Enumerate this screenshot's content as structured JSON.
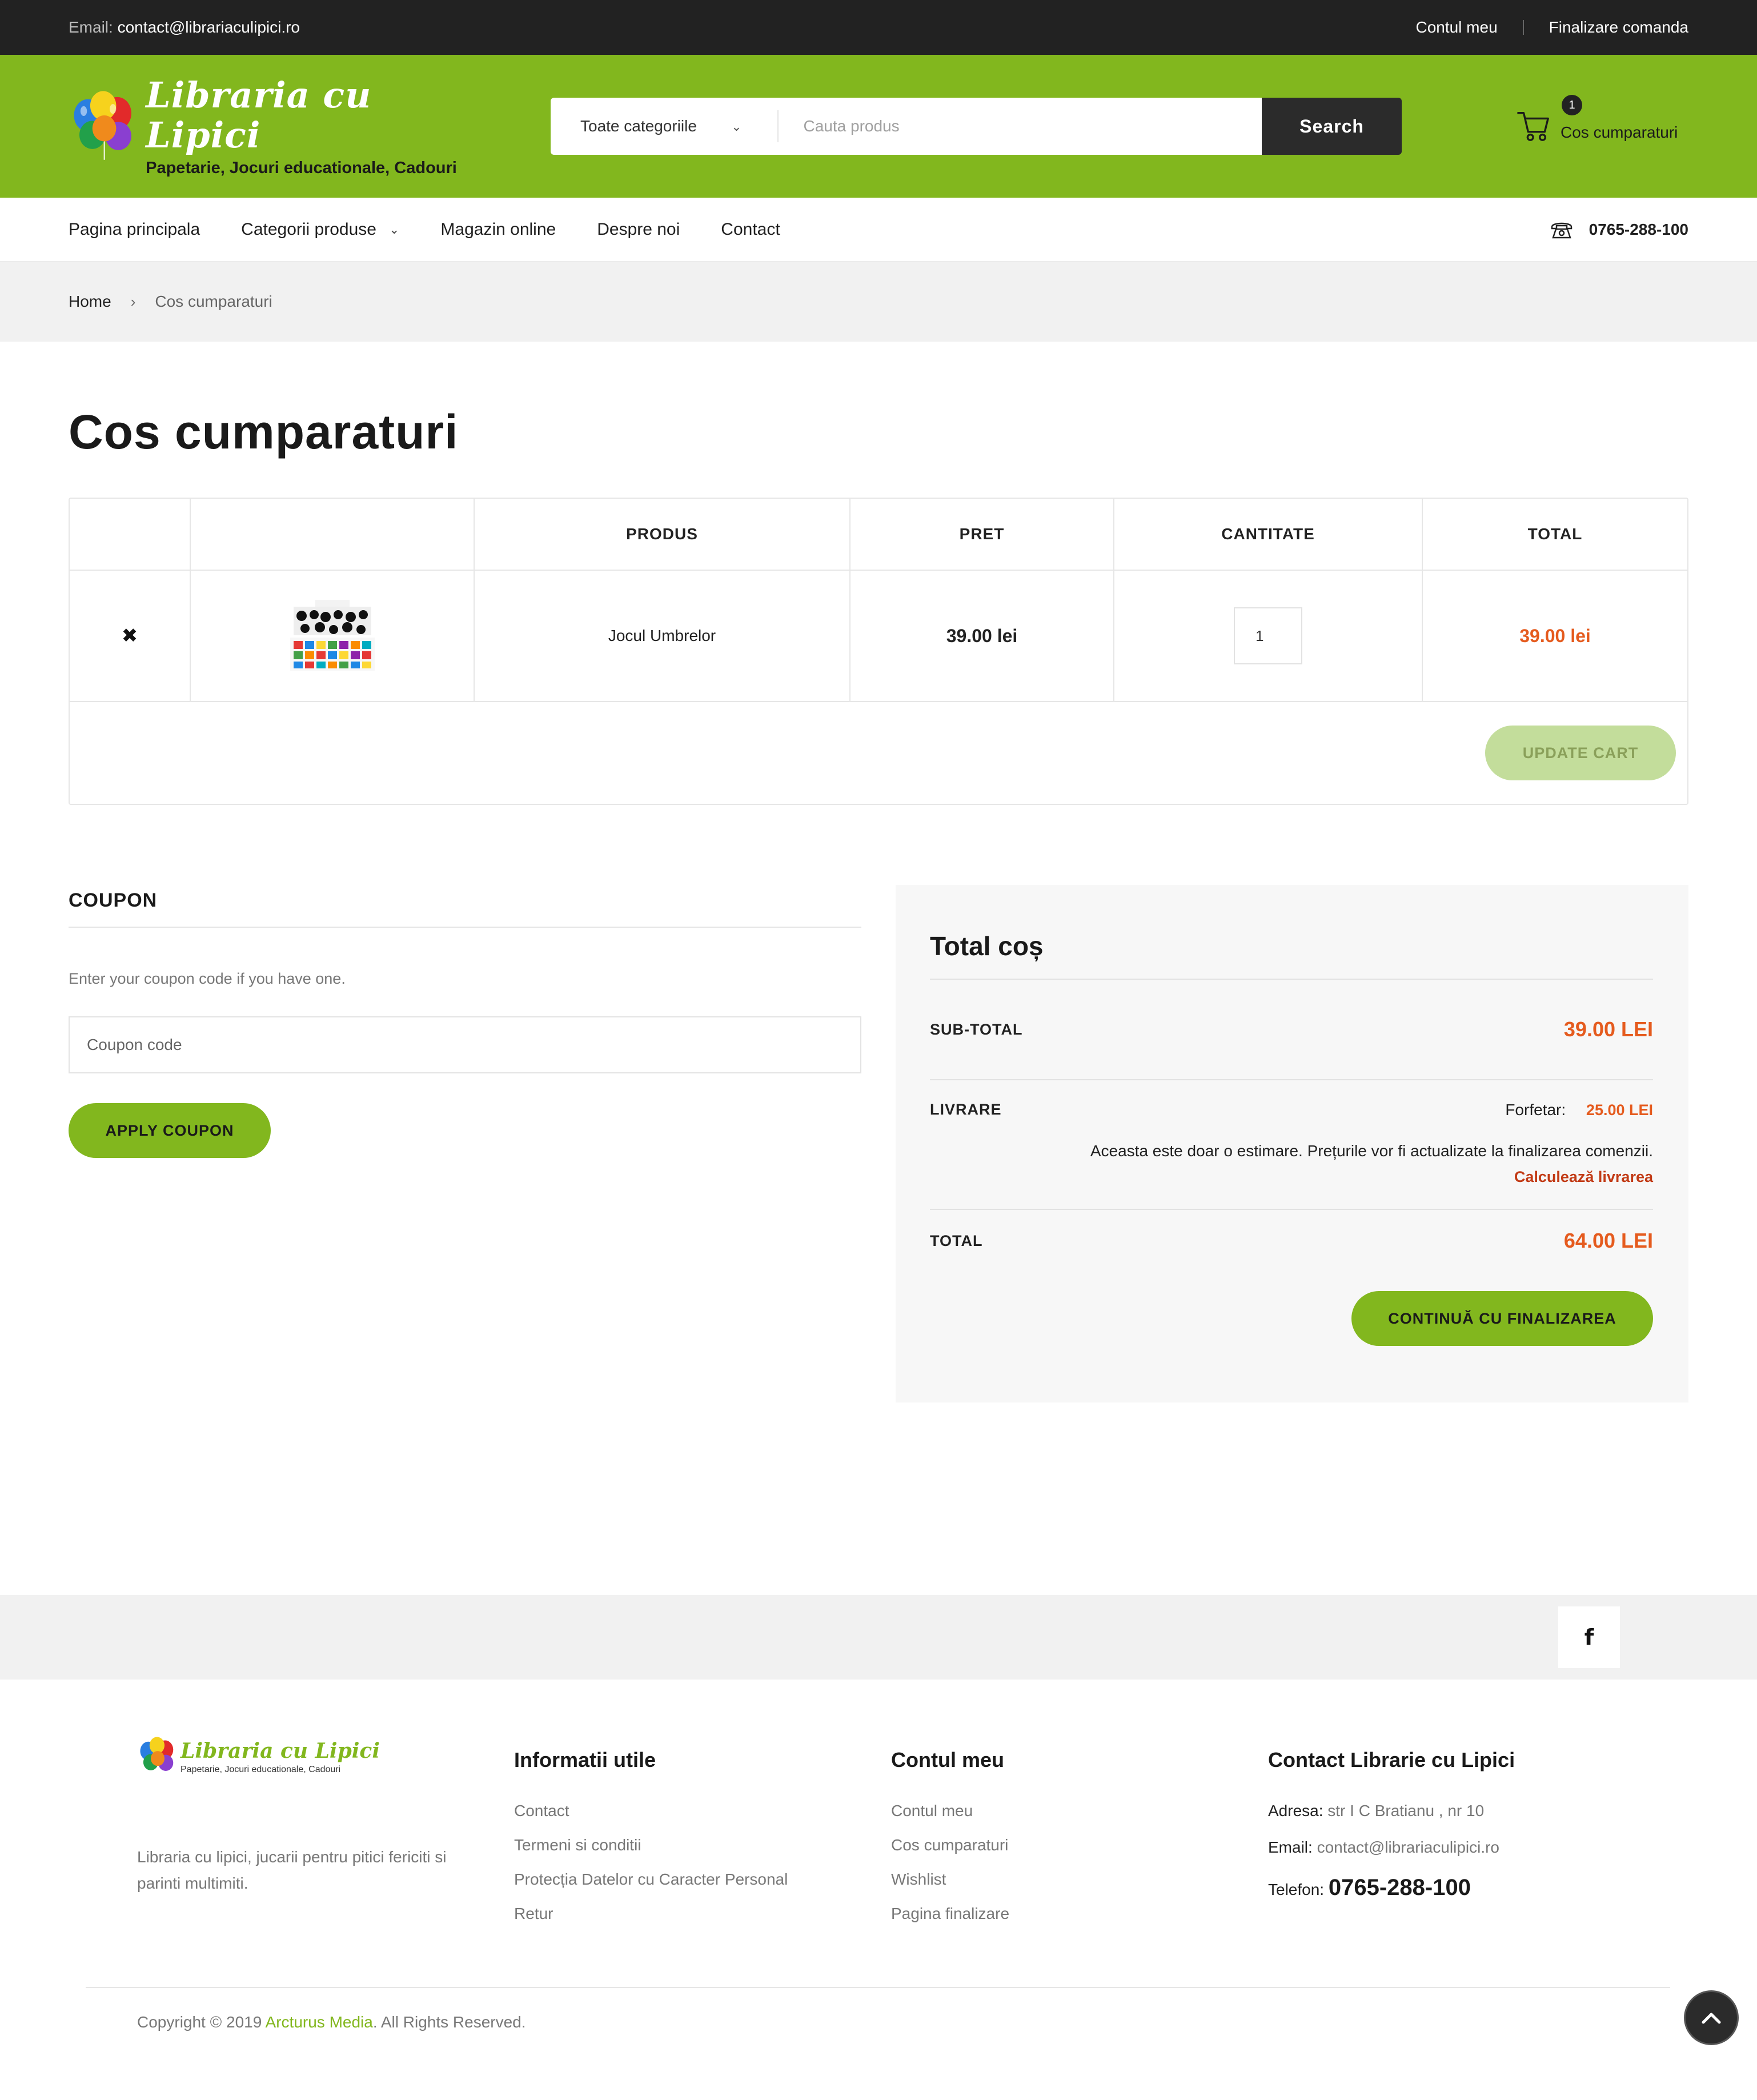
{
  "topbar": {
    "email_label": "Email:",
    "email_value": "contact@librariaculipici.ro",
    "account_link": "Contul meu",
    "checkout_link": "Finalizare comanda"
  },
  "header": {
    "logo_title": "Libraria cu Lipici",
    "logo_subtitle": "Papetarie, Jocuri educationale, Cadouri",
    "search_category": "Toate categoriile",
    "search_placeholder": "Cauta produs",
    "search_button": "Search",
    "cart_count": "1",
    "cart_label": "Cos cumparaturi"
  },
  "nav": {
    "items": [
      "Pagina principala",
      "Categorii produse",
      "Magazin online",
      "Despre noi",
      "Contact"
    ],
    "phone": "0765-288-100"
  },
  "breadcrumb": {
    "home": "Home",
    "current": "Cos cumparaturi"
  },
  "page": {
    "title": "Cos cumparaturi"
  },
  "cart_table": {
    "headers": [
      "",
      "",
      "PRODUS",
      "PRET",
      "CANTITATE",
      "TOTAL"
    ],
    "rows": [
      {
        "product": "Jocul Umbrelor",
        "price": "39.00 lei",
        "quantity": "1",
        "total": "39.00 lei"
      }
    ],
    "update_button": "UPDATE CART"
  },
  "coupon": {
    "title": "COUPON",
    "description": "Enter your coupon code if you have one.",
    "placeholder": "Coupon code",
    "apply_button": "APPLY COUPON"
  },
  "totals": {
    "title": "Total coș",
    "subtotal_label": "SUB-TOTAL",
    "subtotal_value": "39.00 LEI",
    "shipping_label": "LIVRARE",
    "shipping_rate_label": "Forfetar:",
    "shipping_rate_value": "25.00 LEI",
    "shipping_note": "Aceasta este doar o estimare. Prețurile vor fi actualizate la finalizarea comenzii.",
    "shipping_calc_link": "Calculează livrarea",
    "total_label": "TOTAL",
    "total_value": "64.00 LEI",
    "checkout_button": "CONTINUĂ CU FINALIZAREA"
  },
  "social": {
    "facebook_glyph": "f"
  },
  "footer": {
    "logo_title": "Libraria cu Lipici",
    "logo_subtitle": "Papetarie, Jocuri educationale, Cadouri",
    "about": "Libraria cu lipici, jucarii pentru pitici fericiti si parinti multimiti.",
    "info_title": "Informatii utile",
    "info_links": [
      "Contact",
      "Termeni si conditii",
      "Protecția Datelor cu Caracter Personal",
      "Retur"
    ],
    "account_title": "Contul meu",
    "account_links": [
      "Contul meu",
      "Cos cumparaturi",
      "Wishlist",
      "Pagina finalizare"
    ],
    "contact_title": "Contact Librarie cu Lipici",
    "address_label": "Adresa:",
    "address_value": "str I C Bratianu , nr 10",
    "email_label": "Email:",
    "email_value": "contact@librariaculipici.ro",
    "phone_label": "Telefon:",
    "phone_value": "0765-288-100",
    "copyright_prefix": "Copyright © 2019",
    "copyright_brand": "Arcturus Media",
    "copyright_suffix": ". All Rights Reserved."
  },
  "colors": {
    "brand_green": "#82b71e",
    "accent_orange": "#e55b1e",
    "dark": "#222222"
  }
}
